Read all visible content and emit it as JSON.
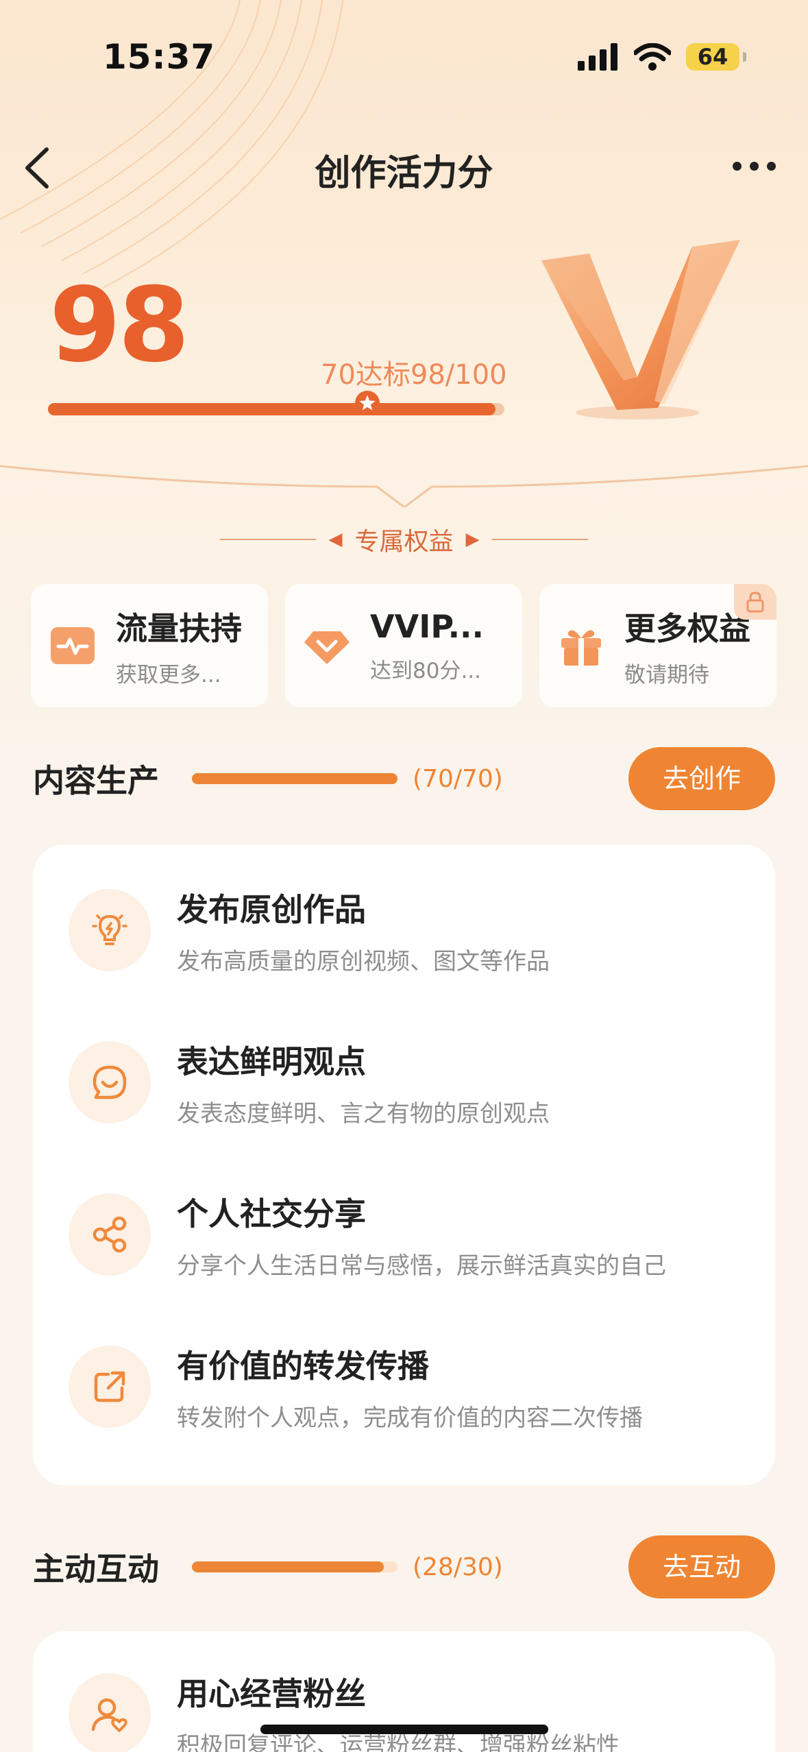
{
  "status": {
    "time": "15:37",
    "battery": "64"
  },
  "nav": {
    "title": "创作活力分"
  },
  "score": {
    "value": "98",
    "note": "70达标98/100",
    "progress": 0.98,
    "threshold": 0.7
  },
  "benefits": {
    "header": "专属权益",
    "cards": [
      {
        "title": "流量扶持",
        "subtitle": "获取更多..."
      },
      {
        "title": "VVIP...",
        "subtitle": "达到80分..."
      },
      {
        "title": "更多权益",
        "subtitle": "敬请期待"
      }
    ]
  },
  "content": {
    "title": "内容生产",
    "count": "(70/70)",
    "progress": 1.0,
    "button": "去创作",
    "items": [
      {
        "title": "发布原创作品",
        "desc": "发布高质量的原创视频、图文等作品"
      },
      {
        "title": "表达鲜明观点",
        "desc": "发表态度鲜明、言之有物的原创观点"
      },
      {
        "title": "个人社交分享",
        "desc": "分享个人生活日常与感悟，展示鲜活真实的自己"
      },
      {
        "title": "有价值的转发传播",
        "desc": "转发附个人观点，完成有价值的内容二次传播"
      }
    ]
  },
  "interaction": {
    "title": "主动互动",
    "count": "(28/30)",
    "progress": 0.933,
    "button": "去互动",
    "items": [
      {
        "title": "用心经营粉丝",
        "desc": "积极回复评论、运营粉丝群、增强粉丝粘性"
      }
    ]
  },
  "colors": {
    "accent": "#ef8533",
    "score": "#e8602c",
    "bg": "#faf4ec"
  }
}
